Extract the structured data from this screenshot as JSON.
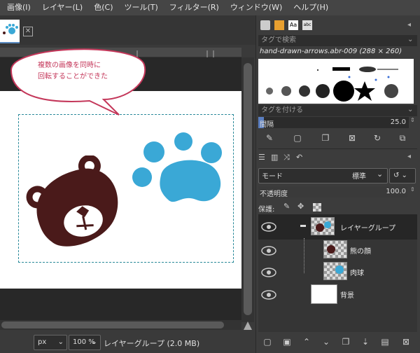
{
  "menubar": [
    "画像(I)",
    "レイヤー(L)",
    "色(C)",
    "ツール(T)",
    "フィルター(R)",
    "ウィンドウ(W)",
    "ヘルプ(H)"
  ],
  "callout": {
    "line1": "複数の画像を同時に",
    "line2": "回転することができた"
  },
  "status": {
    "unit": "px",
    "zoom": "100 %",
    "info": "レイヤーグループ (2.0 MB)"
  },
  "brushes": {
    "tag_placeholder": "タグで検索",
    "name": "hand-drawn-arrows.abr-009 (288 × 260)",
    "attach_placeholder": "タグを付ける",
    "spacing_label": "間隔",
    "spacing_value": "25.0"
  },
  "layers": {
    "mode_label": "モード",
    "mode_value": "標準",
    "opacity_label": "不透明度",
    "opacity_value": "100.0",
    "lock_label": "保護:",
    "items": [
      {
        "name": "レイヤーグループ"
      },
      {
        "name": "熊の顔"
      },
      {
        "name": "肉球"
      },
      {
        "name": "背景"
      }
    ]
  },
  "colors": {
    "bear": "#4a1a1a",
    "paw": "#3aa8d6",
    "callout": "#c4375a",
    "selection": "#2a8a9a"
  }
}
